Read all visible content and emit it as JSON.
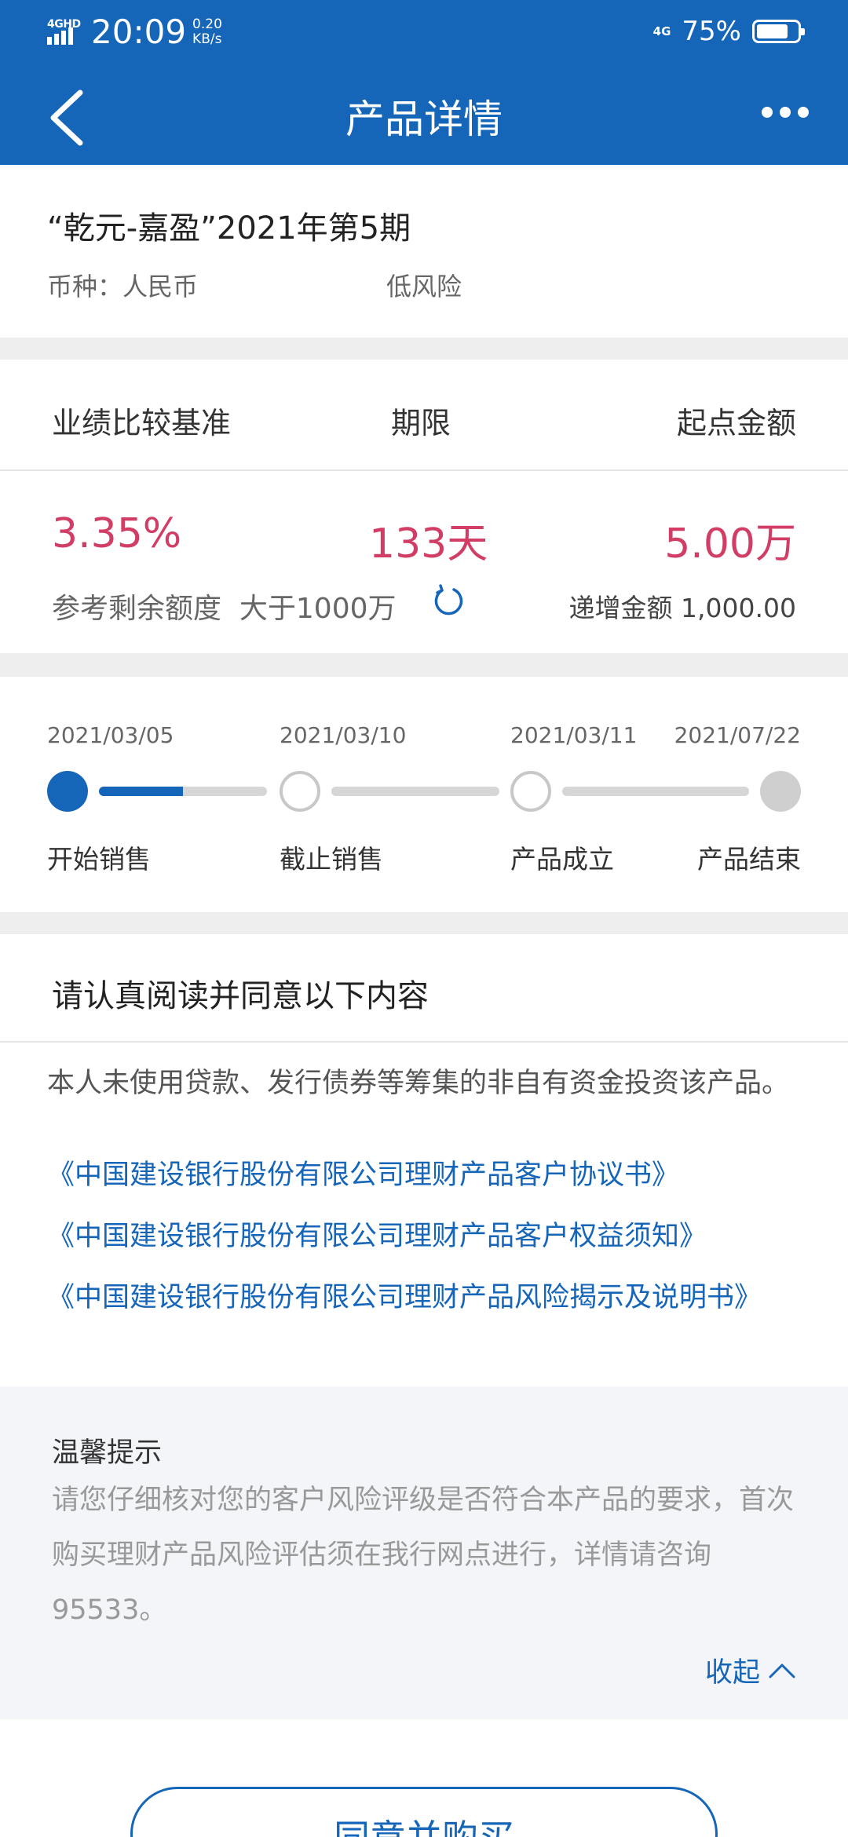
{
  "status_bar": {
    "network": "4GHD",
    "time": "20:09",
    "speed_value": "0.20",
    "speed_unit": "KB/s",
    "network_right": "4G",
    "battery": "75%"
  },
  "header": {
    "title": "产品详情",
    "back_icon": "chevron-left-icon",
    "more_icon": "more-horizontal-icon"
  },
  "product": {
    "name": "“乾元-嘉盈”2021年第5期",
    "currency": "币种：人民币",
    "risk": "低风险"
  },
  "stats": {
    "headers": [
      "业绩比较基准",
      "期限",
      "起点金额"
    ],
    "values": [
      "3.35%",
      "133天",
      "5.00万"
    ],
    "remaining_label": "参考剩余额度",
    "remaining_value": "大于1000万",
    "increment_label": "递增金额",
    "increment_value": "1,000.00"
  },
  "timeline": {
    "steps": [
      {
        "date": "2021/03/05",
        "label": "开始销售"
      },
      {
        "date": "2021/03/10",
        "label": "截止销售"
      },
      {
        "date": "2021/03/11",
        "label": "产品成立"
      },
      {
        "date": "2021/07/22",
        "label": "产品结束"
      }
    ],
    "first_segment_progress": 0.5
  },
  "agreement": {
    "title": "请认真阅读并同意以下内容",
    "statement": "本人未使用贷款、发行债券等筹集的非自有资金投资该产品。",
    "links": [
      "《中国建设银行股份有限公司理财产品客户协议书》",
      "《中国建设银行股份有限公司理财产品客户权益须知》",
      "《中国建设银行股份有限公司理财产品风险揭示及说明书》"
    ]
  },
  "tips": {
    "title": "温馨提示",
    "text": "请您仔细核对您的客户风险评级是否符合本产品的要求，首次购买理财产品风险评估须在我行网点进行，详情请咨询95533。",
    "collapse": "收起"
  },
  "action": {
    "buy": "同意并购买"
  },
  "colors": {
    "primary": "#1565b9",
    "highlight": "#d13d64"
  }
}
